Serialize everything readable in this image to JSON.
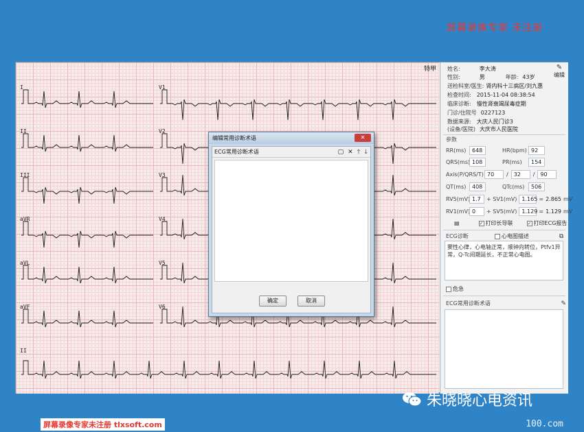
{
  "top_watermark": "屏幕录像专家 未注册",
  "ecg": {
    "speed_label": "特甲",
    "leads_left": [
      "I",
      "II",
      "III",
      "aVR",
      "aVL",
      "aVF"
    ],
    "leads_right": [
      "V1",
      "V2",
      "V3",
      "V4",
      "V5",
      "V6"
    ],
    "rhythm_lead": "II"
  },
  "patient": {
    "name_label": "姓名:",
    "name": "李大涛",
    "sex_label": "性别:",
    "sex": "男",
    "age_label": "年龄:",
    "age": "43岁",
    "dept_label": "送检科室/医生:",
    "dept": "肾内科十三病区/刘九惠",
    "time_label": "检查时间:",
    "time": "2015-11-04 08:38:54",
    "dx_label": "临床诊断:",
    "dx": "慢性肾衰竭尿毒症期",
    "id_label": "门诊/住院号",
    "id": "0227123",
    "source_label": "数据来源:",
    "source": "大庆人民门诊3",
    "hospital_label": "(设备/医院)",
    "hospital": "大庆市人民医院",
    "edit_label": "编辑"
  },
  "params": {
    "title": "参数",
    "rr_label": "RR(ms)",
    "rr": "648",
    "hr_label": "HR(bpm)",
    "hr": "92",
    "qrs_label": "QRS(ms)",
    "qrs": "108",
    "pr_label": "PR(ms)",
    "pr": "154",
    "axis_label": "Axis(P/QRS/T)",
    "axis_p": "70",
    "axis_qrs": "32",
    "axis_t": "90",
    "qt_label": "QT(ms)",
    "qt": "408",
    "qtc_label": "QTc(ms)",
    "qtc": "506",
    "rv5_label": "RV5(mV)",
    "rv5": "1.7",
    "sv1_label": "+ SV1(mV)",
    "sv1": "1.165",
    "sum1": "2.865",
    "unit1": "mV",
    "rv1_label": "RV1(mV)",
    "rv1": "0",
    "sv5_label": "+ SV5(mV)",
    "sv5": "1.129",
    "sum2": "1.129",
    "unit2": "mV",
    "print_long_label": "打印长导联",
    "print_ecg_label": "打印ECG报告"
  },
  "findings": {
    "title": "ECG诊断",
    "desc_label": "心电图描述",
    "text": "窦性心律，心电轴正常，顺钟向转位，Ptfv1异常，Q-Tc间期延长，不正常心电图。",
    "critical_label": "危急"
  },
  "common_terms": {
    "title": "ECG常用诊断术语"
  },
  "dialog": {
    "title": "编辑常用诊断术语",
    "close": "✕",
    "list_header": "ECG常用诊断术语",
    "ok": "确定",
    "cancel": "取消"
  },
  "wechat_brand": "朱晓晓心电资讯",
  "site_mark": "100.com",
  "bottom_watermark": "屏幕录像专家未注册 tlxsoft.com"
}
